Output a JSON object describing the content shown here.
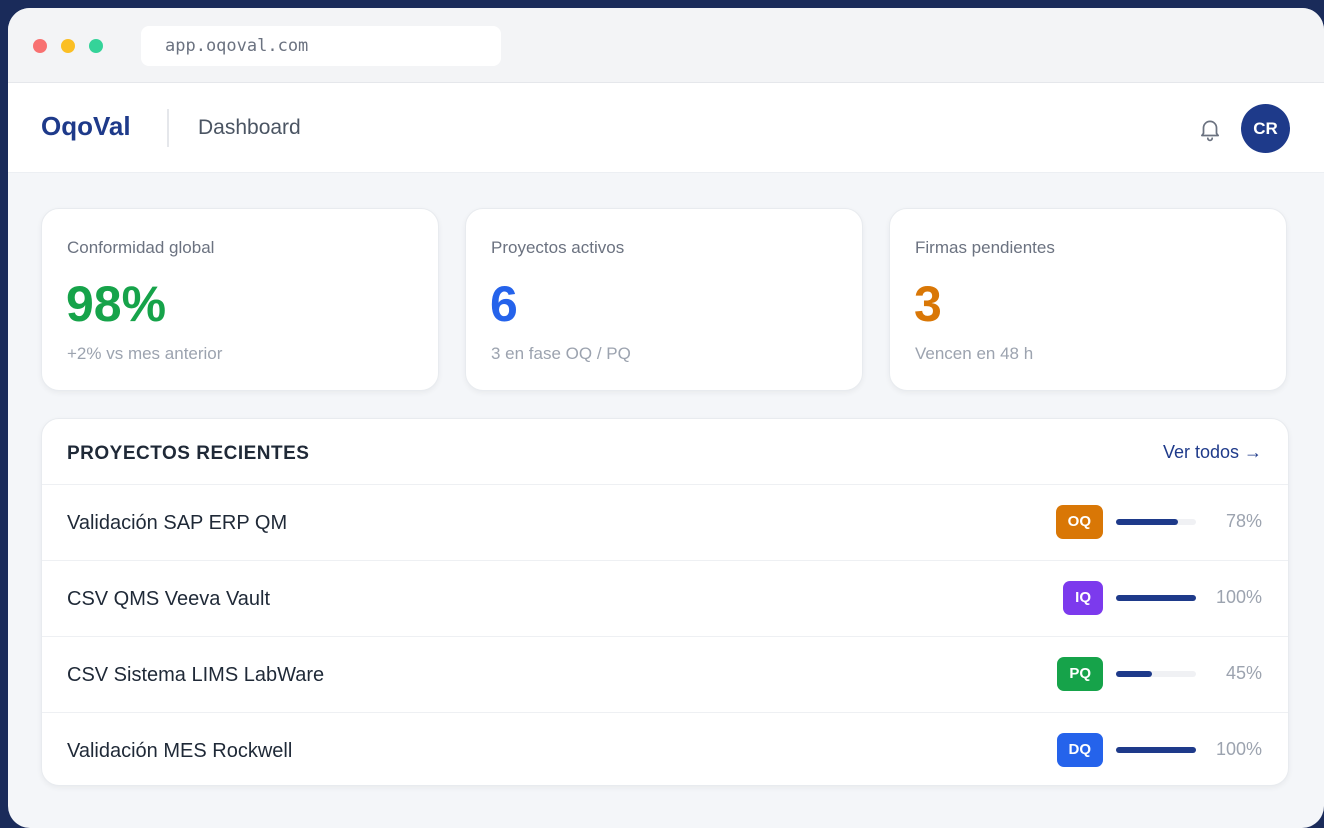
{
  "browser": {
    "url": "app.oqoval.com"
  },
  "header": {
    "logo": "OqoVal",
    "page_title": "Dashboard",
    "avatar_initials": "CR"
  },
  "stats": [
    {
      "label": "Conformidad global",
      "value": "98%",
      "sub": "+2% vs mes anterior",
      "color": "#16a34a"
    },
    {
      "label": "Proyectos activos",
      "value": "6",
      "sub": "3 en fase OQ / PQ",
      "color": "#2563eb"
    },
    {
      "label": "Firmas pendientes",
      "value": "3",
      "sub": "Vencen en 48 h",
      "color": "#d97706"
    }
  ],
  "projects": {
    "title": "PROYECTOS RECIENTES",
    "view_all": "Ver todos →",
    "rows": [
      {
        "name": "Validación SAP ERP QM",
        "phase": "OQ",
        "phase_color": "#d97706",
        "progress": 78,
        "progress_label": "78%"
      },
      {
        "name": "CSV QMS Veeva Vault",
        "phase": "IQ",
        "phase_color": "#7c3aed",
        "progress": 100,
        "progress_label": "100%"
      },
      {
        "name": "CSV Sistema LIMS LabWare",
        "phase": "PQ",
        "phase_color": "#16a34a",
        "progress": 45,
        "progress_label": "45%"
      },
      {
        "name": "Validación MES Rockwell",
        "phase": "DQ",
        "phase_color": "#2563eb",
        "progress": 100,
        "progress_label": "100%"
      }
    ]
  }
}
